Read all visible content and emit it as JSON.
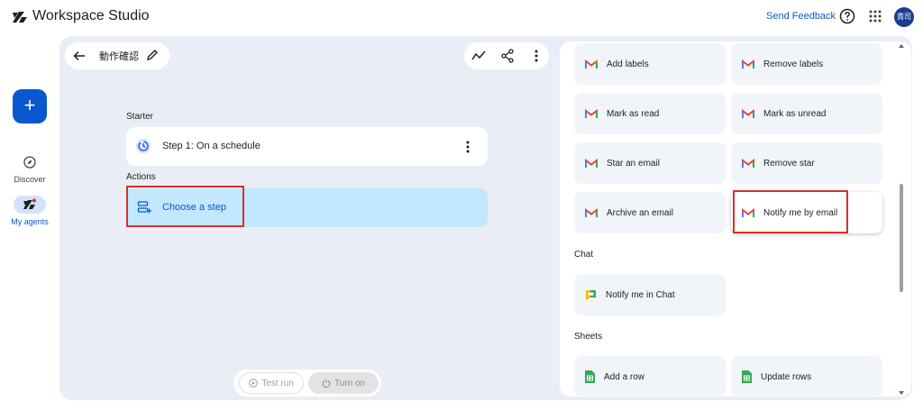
{
  "header": {
    "app_title": "Workspace Studio",
    "send_feedback": "Send Feedback",
    "avatar_text": "貴司",
    "icons": [
      "studio-logo-icon",
      "help-icon",
      "apps-grid-icon"
    ]
  },
  "rail": {
    "create_label": "+",
    "items": [
      {
        "label": "Discover",
        "icon": "compass-icon",
        "active": false
      },
      {
        "label": "My agents",
        "icon": "agents-icon",
        "active": true
      }
    ]
  },
  "flow": {
    "title": "動作確認",
    "starter_label": "Starter",
    "step_prefix": "Step 1:",
    "step_text": "On a schedule",
    "actions_label": "Actions",
    "choose_step": "Choose a step",
    "test_run": "Test run",
    "turn_on": "Turn on"
  },
  "panel": {
    "tiles": [
      {
        "label": "Add labels",
        "icon": "gmail-icon"
      },
      {
        "label": "Remove labels",
        "icon": "gmail-icon"
      },
      {
        "label": "Mark as read",
        "icon": "gmail-icon"
      },
      {
        "label": "Mark as unread",
        "icon": "gmail-icon"
      },
      {
        "label": "Star an email",
        "icon": "gmail-icon"
      },
      {
        "label": "Remove star",
        "icon": "gmail-icon"
      },
      {
        "label": "Archive an email",
        "icon": "gmail-icon"
      },
      {
        "label": "Notify me by email",
        "icon": "gmail-icon"
      }
    ],
    "chat_section": "Chat",
    "chat_tiles": [
      {
        "label": "Notify me in Chat",
        "icon": "google-chat-icon"
      }
    ],
    "sheets_section": "Sheets",
    "sheets_tiles": [
      {
        "label": "Add a row",
        "icon": "google-sheets-icon"
      },
      {
        "label": "Update rows",
        "icon": "google-sheets-icon"
      }
    ]
  },
  "colors": {
    "accent": "#0b57d0",
    "canvas_bg": "#e9eef6",
    "selected_step_bg": "#c2e7ff",
    "highlight_border": "#d93025"
  }
}
